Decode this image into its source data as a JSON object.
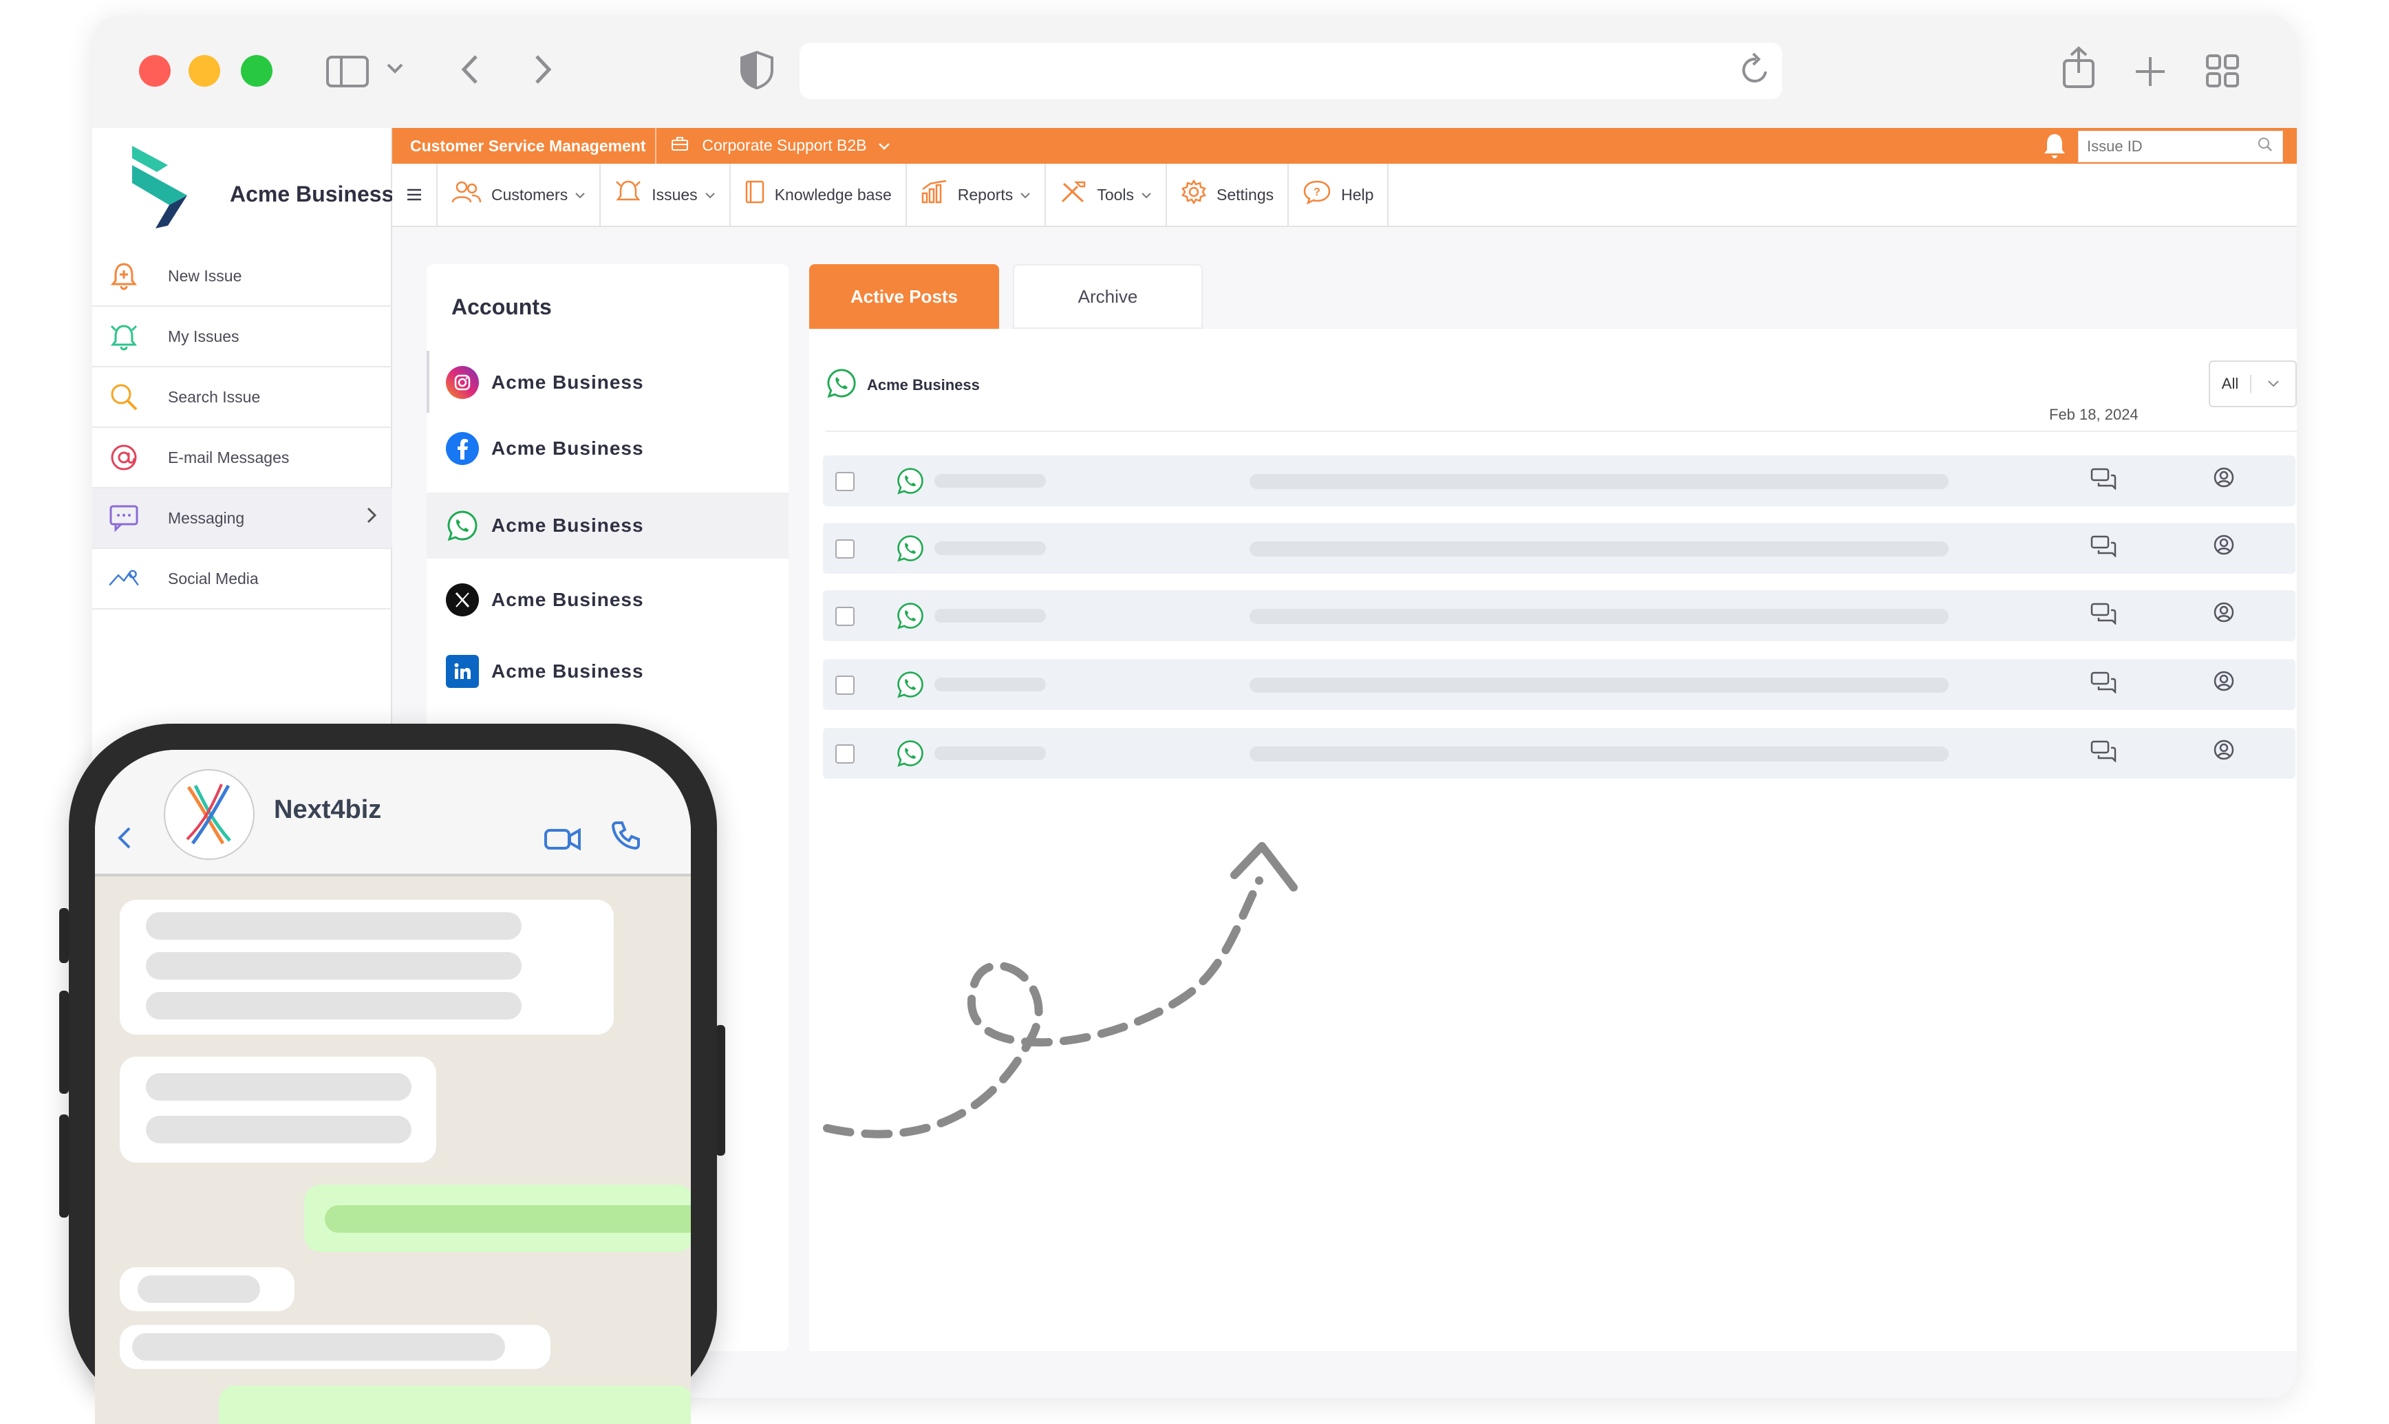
{
  "browser": {
    "window_controls": [
      "close",
      "minimize",
      "zoom"
    ],
    "colors": {
      "close": "#ff5f57",
      "minimize": "#febc2e",
      "zoom": "#28c840"
    },
    "toolbar_icons": [
      "sidebar-icon",
      "chevron-down-icon",
      "back-icon",
      "forward-icon",
      "shield-icon",
      "reload-icon",
      "share-icon",
      "new-tab-icon",
      "tab-overview-icon"
    ],
    "address_value": ""
  },
  "app": {
    "brand": "Acme Business",
    "accent_color": "#f5853a",
    "topbar": {
      "module": "Customer Service Management",
      "workspace": "Corporate Support B2B",
      "issue_search_placeholder": "Issue ID"
    },
    "nav": [
      {
        "label": "Customers",
        "icon": "customers-icon",
        "dropdown": true
      },
      {
        "label": "Issues",
        "icon": "issues-icon",
        "dropdown": true
      },
      {
        "label": "Knowledge base",
        "icon": "book-icon",
        "dropdown": false
      },
      {
        "label": "Reports",
        "icon": "reports-icon",
        "dropdown": true
      },
      {
        "label": "Tools",
        "icon": "tools-icon",
        "dropdown": true
      },
      {
        "label": "Settings",
        "icon": "gear-icon",
        "dropdown": false
      },
      {
        "label": "Help",
        "icon": "help-icon",
        "dropdown": false
      }
    ],
    "sidebar": [
      {
        "label": "New Issue",
        "icon": "new-issue-icon"
      },
      {
        "label": "My Issues",
        "icon": "my-issues-icon"
      },
      {
        "label": "Search Issue",
        "icon": "search-icon"
      },
      {
        "label": "E-mail Messages",
        "icon": "email-icon"
      },
      {
        "label": "Messaging",
        "icon": "messaging-icon",
        "active": true
      },
      {
        "label": "Social Media",
        "icon": "social-media-icon"
      }
    ],
    "accounts": {
      "title": "Accounts",
      "items": [
        {
          "name": "Acme Business",
          "network": "instagram"
        },
        {
          "name": "Acme Business",
          "network": "facebook"
        },
        {
          "name": "Acme Business",
          "network": "whatsapp",
          "selected": true
        },
        {
          "name": "Acme Business",
          "network": "x"
        },
        {
          "name": "Acme Business",
          "network": "linkedin"
        }
      ]
    },
    "tabs": [
      {
        "label": "Active Posts",
        "active": true
      },
      {
        "label": "Archive",
        "active": false
      }
    ],
    "posts": {
      "account": "Acme Business",
      "filter_value": "All",
      "date": "Feb 18, 2024",
      "row_count": 5
    }
  },
  "phone": {
    "contact_name": "Next4biz"
  }
}
